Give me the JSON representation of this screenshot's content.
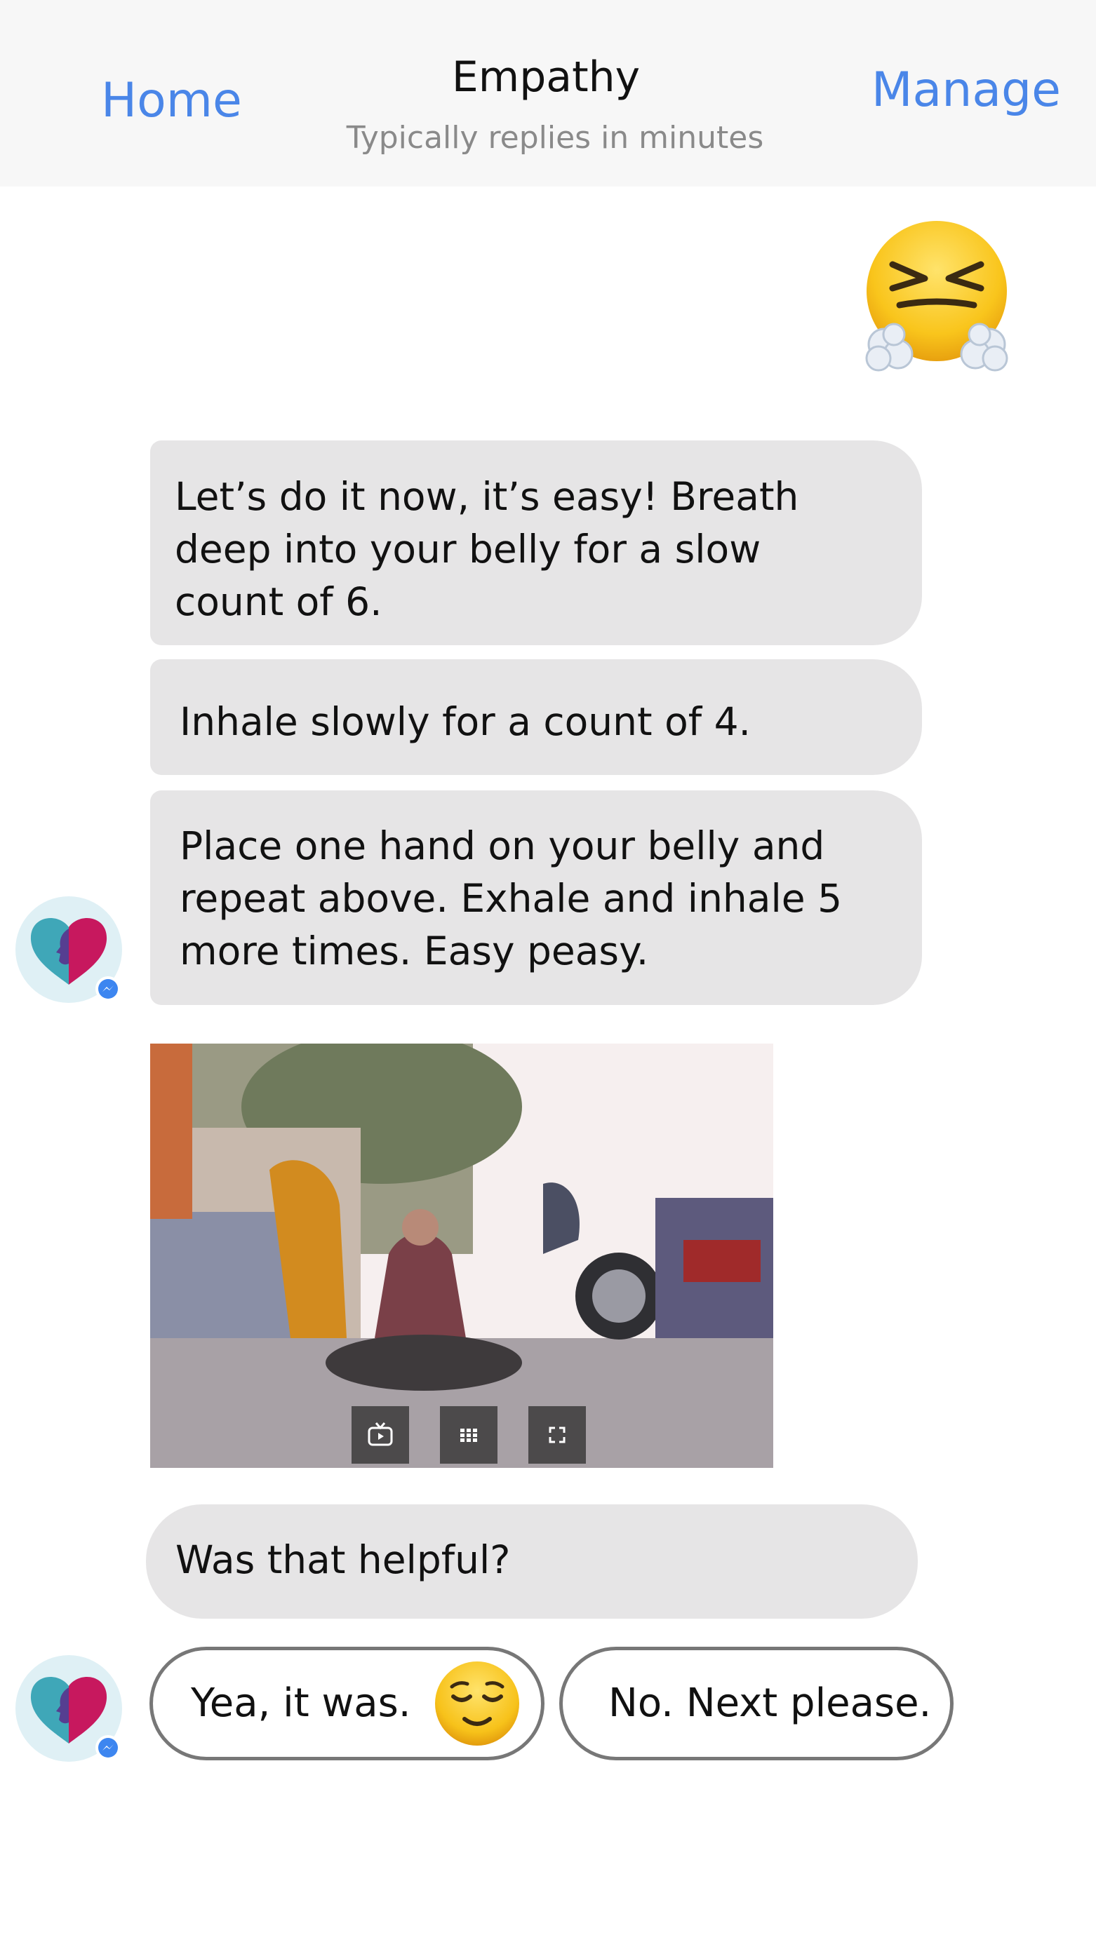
{
  "header": {
    "home_label": "Home",
    "title": "Empathy",
    "subtitle": "Typically replies in minutes",
    "manage_label": "Manage"
  },
  "messages": [
    {
      "text_lines": [
        "Let’s do it now, it’s easy! Breath",
        "deep into your belly for a slow",
        "count of 6."
      ]
    },
    {
      "text_lines": [
        "Inhale slowly for a count of 4."
      ]
    },
    {
      "text_lines": [
        "Place one hand on your belly and",
        "repeat above. Exhale and inhale 5",
        "more times. Easy peasy."
      ]
    },
    {
      "text_lines": [
        "Was that helpful?"
      ]
    }
  ],
  "quick_replies": [
    {
      "label": "Yea, it was.",
      "icon": "relieved-face-icon"
    },
    {
      "label": "No. Next please."
    }
  ],
  "icons": {
    "sent_emoji": "face-with-steam-icon",
    "bot_avatar": "empathy-heart-logo",
    "avatar_badge": "messenger-badge-icon",
    "photo_controls": [
      "tv-icon",
      "grid-icon",
      "fullscreen-icon"
    ]
  },
  "colors": {
    "link": "#4a86e8",
    "bubble": "#e6e5e6",
    "header_bg": "#f7f7f7"
  }
}
